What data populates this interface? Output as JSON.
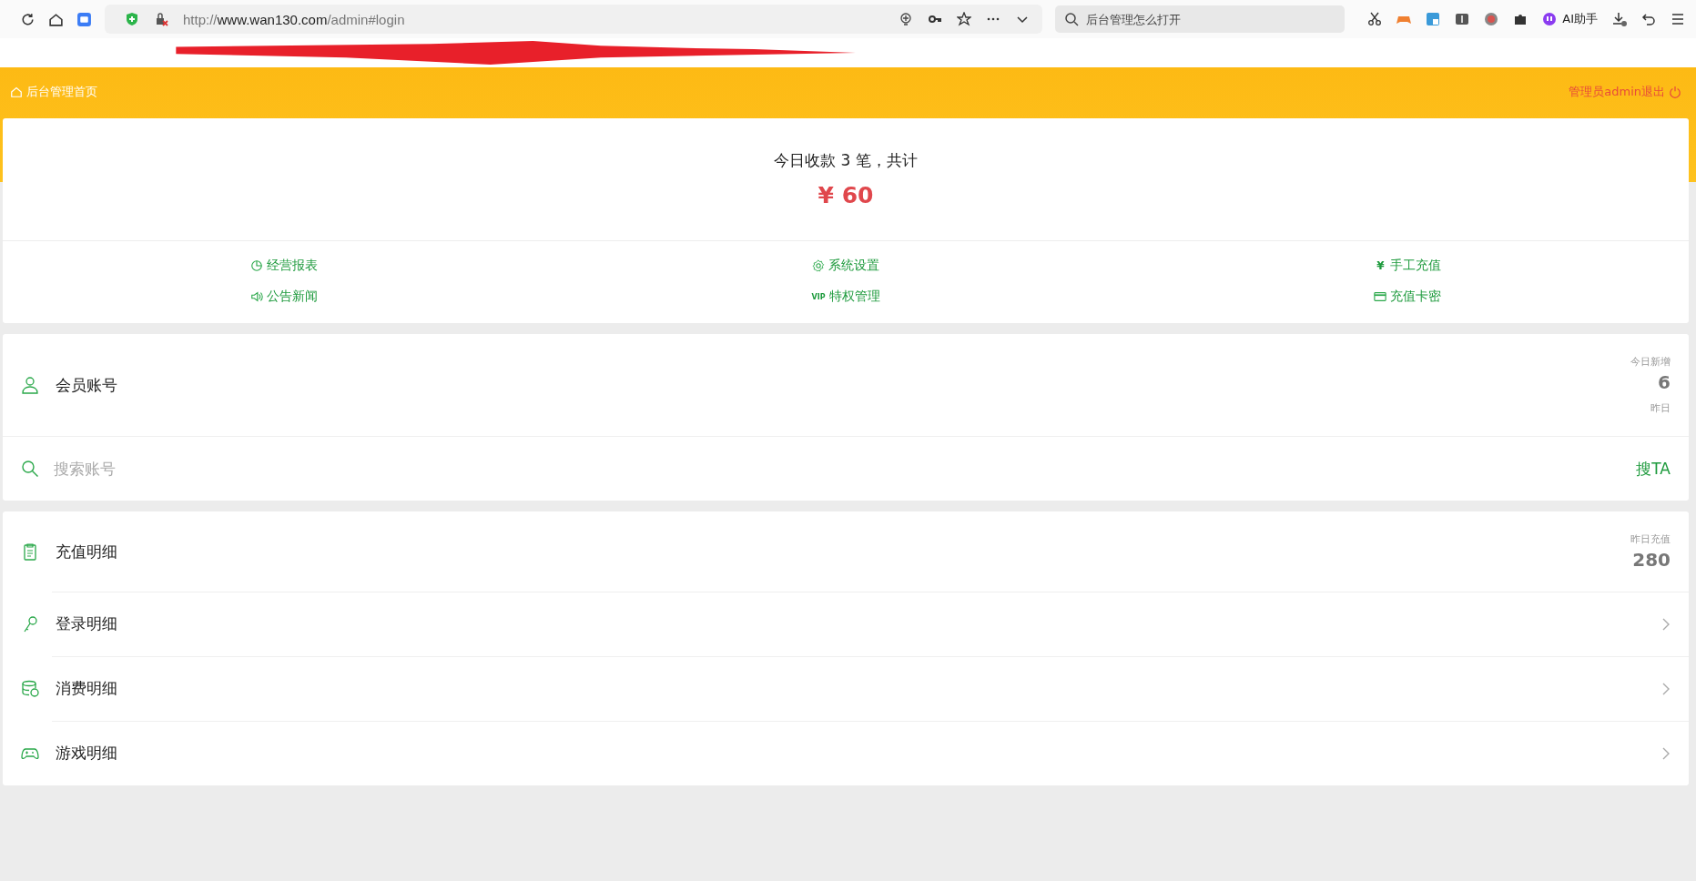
{
  "browser": {
    "address": {
      "scheme": "http://",
      "host": "www.wan130.com",
      "path": "/admin#login"
    },
    "search": {
      "placeholder": "后台管理怎么打开"
    },
    "assistant_label": "AI助手"
  },
  "header": {
    "home_link": "后台管理首页",
    "logout_link": "管理员admin退出"
  },
  "summary": {
    "text": "今日收款 3 笔，共计",
    "amount": "¥ 60"
  },
  "quick_links": [
    {
      "label": "经营报表"
    },
    {
      "label": "系统设置"
    },
    {
      "label": "手工充值",
      "icon_text": "¥"
    },
    {
      "label": "公告新闻"
    },
    {
      "label": "特权管理",
      "icon_text": "VIP"
    },
    {
      "label": "充值卡密"
    }
  ],
  "member": {
    "title": "会员账号",
    "stat_label": "今日新增",
    "stat_value": "6",
    "stat_sub": "昨日",
    "search_placeholder": "搜索账号",
    "search_button": "搜TA"
  },
  "details": [
    {
      "label": "充值明细",
      "kind": "stat",
      "stat_label": "昨日充值",
      "stat_value": "280"
    },
    {
      "label": "登录明细",
      "kind": "link"
    },
    {
      "label": "消费明细",
      "kind": "link"
    },
    {
      "label": "游戏明细",
      "kind": "link"
    }
  ]
}
